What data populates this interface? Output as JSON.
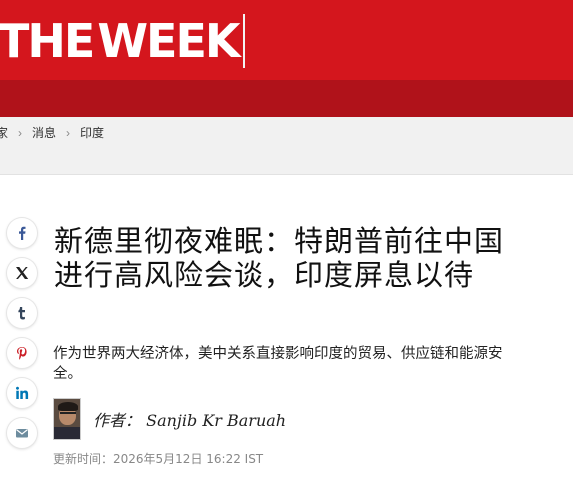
{
  "header": {
    "logo_the": "THE",
    "logo_week": "WEEK"
  },
  "breadcrumb": {
    "items": [
      "家",
      "消息",
      "印度"
    ]
  },
  "share": {
    "icons": [
      "facebook-icon",
      "x-twitter-icon",
      "tumblr-icon",
      "pinterest-icon",
      "linkedin-icon",
      "email-icon"
    ]
  },
  "article": {
    "headline": "新德里彻夜难眠：特朗普前往中国进行高风险会谈，印度屏息以待",
    "dek": "作为世界两大经济体，美中关系直接影响印度的贸易、供应链和能源安全。",
    "byline_label": "作者：",
    "author_name": "Sanjib Kr Baruah",
    "updated": "更新时间：2026年5月12日 16:22 IST"
  },
  "colors": {
    "brand_red": "#d4161d",
    "subbar_red": "#b0121a",
    "breadcrumb_bg": "#f1f1f1"
  }
}
